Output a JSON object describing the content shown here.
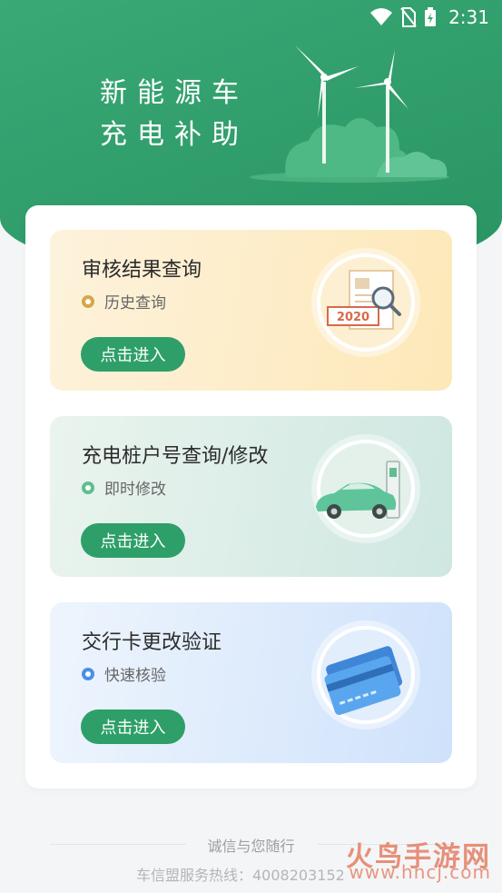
{
  "status": {
    "time": "2:31"
  },
  "hero": {
    "line1": "新能源车",
    "line2": "充电补助"
  },
  "cards": [
    {
      "title": "审核结果查询",
      "subtitle": "历史查询",
      "button": "点击进入",
      "dot_color": "#d4a84a",
      "illu_text": "2020"
    },
    {
      "title": "充电桩户号查询/修改",
      "subtitle": "即时修改",
      "button": "点击进入",
      "dot_color": "#5fbf8e"
    },
    {
      "title": "交行卡更改验证",
      "subtitle": "快速核验",
      "button": "点击进入",
      "dot_color": "#4b8fe6"
    }
  ],
  "footer": {
    "slogan": "诚信与您随行",
    "hotline": "车信盟服务热线：4008203152"
  },
  "watermark": {
    "name": "火鸟手游网",
    "url": "www.hncj.com"
  },
  "colors": {
    "primary": "#2e9f69"
  }
}
